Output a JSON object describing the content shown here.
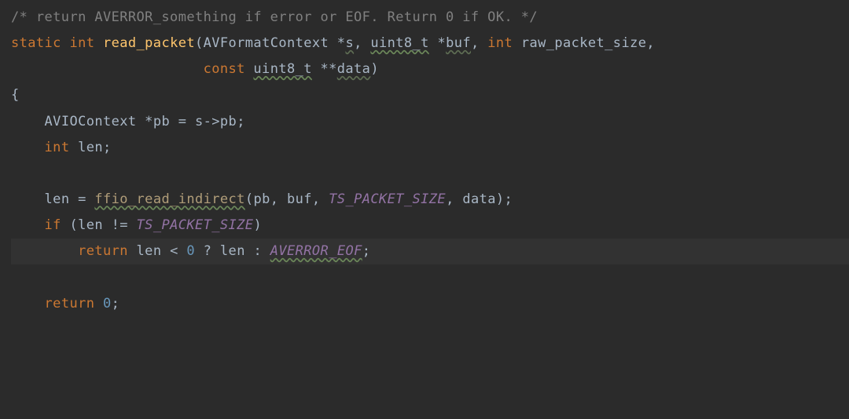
{
  "code": {
    "line1": {
      "comment": "/* return AVERROR_something if error or EOF. Return 0 if OK. */"
    },
    "line2": {
      "kw_static": "static ",
      "kw_int": "int ",
      "func": "read_packet",
      "paren": "(",
      "type1": "AVFormatContext ",
      "ptr1": "*",
      "param1": "s",
      "comma1": ", ",
      "type2": "uint8_t",
      "ptr2": " *",
      "param2": "buf",
      "comma2": ", ",
      "kw_int2": "int ",
      "param3": "raw_packet_size",
      "comma3": ","
    },
    "line3": {
      "indent": "                       ",
      "kw_const": "const ",
      "type": "uint8_t",
      "ptrs": " **",
      "param": "data",
      "close": ")"
    },
    "line4": {
      "brace": "{"
    },
    "line5": {
      "indent": "    ",
      "type": "AVIOContext ",
      "ptr": "*",
      "var": "pb ",
      "assign": "= ",
      "rhs": "s->pb",
      "semi": ";"
    },
    "line6": {
      "indent": "    ",
      "kw_int": "int ",
      "var": "len",
      "semi": ";"
    },
    "line7": {
      "blank": " "
    },
    "line8": {
      "indent": "    ",
      "lhs": "len ",
      "assign": "= ",
      "call": "ffio_read_indirect",
      "args": "(pb, buf, ",
      "const1": "TS_PACKET_SIZE",
      "args2": ", data)",
      "semi": ";"
    },
    "line9": {
      "indent": "    ",
      "kw_if": "if ",
      "open": "(",
      "lhs": "len ",
      "op": "!= ",
      "const1": "TS_PACKET_SIZE",
      "close": ")"
    },
    "line10": {
      "indent": "        ",
      "kw_return": "return ",
      "lhs": "len ",
      "op1": "< ",
      "num": "0",
      "op2": " ? ",
      "mid": "len ",
      "op3": ": ",
      "const1": "AVERROR_EOF",
      "semi": ";"
    },
    "line11": {
      "blank": " "
    },
    "line12": {
      "indent": "    ",
      "kw_return": "return ",
      "num": "0",
      "semi": ";"
    }
  }
}
